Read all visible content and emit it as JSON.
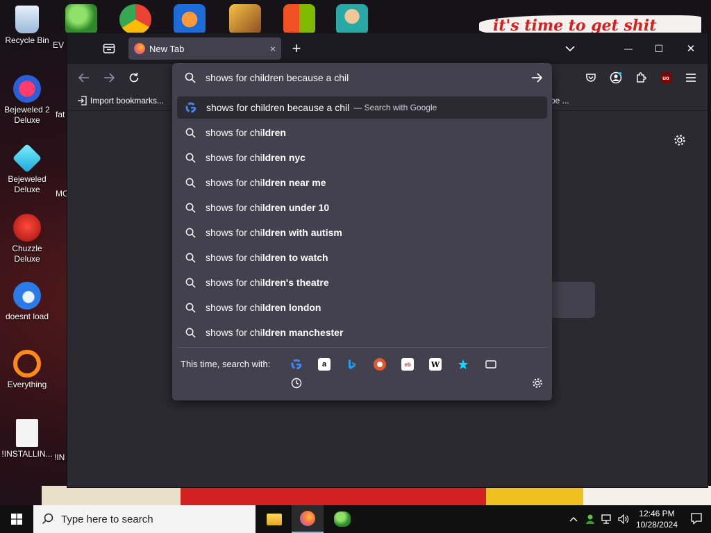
{
  "desktop": {
    "icons": [
      {
        "label": "Recycle Bin"
      },
      {
        "label": "Bejeweled 2 Deluxe"
      },
      {
        "label": "Bejeweled Deluxe"
      },
      {
        "label": "Chuzzle Deluxe"
      },
      {
        "label": "doesnt load"
      },
      {
        "label": "Everything"
      },
      {
        "label": "!INSTALLIN..."
      }
    ],
    "partial_labels": [
      "EV",
      "M",
      "fat",
      "MC",
      "f",
      "!IN"
    ],
    "banner_text": "it's time to get shit"
  },
  "browser": {
    "tab": {
      "title": "New Tab",
      "close": "×"
    },
    "new_tab": "+",
    "window_controls": {
      "minimize": "—",
      "maximize": "☐",
      "close": "✕"
    },
    "list_all_tabs": "⌄",
    "bookmarks": {
      "import": "Import bookmarks...",
      "right_partial": "pe ..."
    },
    "url": {
      "value": "shows for children because a chil",
      "suggestions": [
        {
          "prefix": "shows for children because a chil",
          "bold": "",
          "hint": "— Search with Google",
          "icon": "google-icon",
          "selected": true
        },
        {
          "prefix": "shows for chi",
          "bold": "ldren",
          "hint": "",
          "icon": "search-icon"
        },
        {
          "prefix": "shows for chi",
          "bold": "ldren nyc",
          "hint": "",
          "icon": "search-icon"
        },
        {
          "prefix": "shows for chi",
          "bold": "ldren near me",
          "hint": "",
          "icon": "search-icon"
        },
        {
          "prefix": "shows for chi",
          "bold": "ldren under 10",
          "hint": "",
          "icon": "search-icon"
        },
        {
          "prefix": "shows for chi",
          "bold": "ldren with autism",
          "hint": "",
          "icon": "search-icon"
        },
        {
          "prefix": "shows for chi",
          "bold": "ldren to watch",
          "hint": "",
          "icon": "search-icon"
        },
        {
          "prefix": "shows for chi",
          "bold": "ldren's theatre",
          "hint": "",
          "icon": "search-icon"
        },
        {
          "prefix": "shows for chi",
          "bold": "ldren london",
          "hint": "",
          "icon": "search-icon"
        },
        {
          "prefix": "shows for chi",
          "bold": "ldren manchester",
          "hint": "",
          "icon": "search-icon"
        }
      ],
      "search_with_label": "This time, search with:",
      "engines": [
        "google-icon",
        "amazon-icon",
        "bing-icon",
        "duckduckgo-icon",
        "ebay-icon",
        "wikipedia-icon",
        "bookmarks-star-icon",
        "tabs-icon",
        "history-icon"
      ],
      "engine_glyphs": {
        "amazon": "a",
        "ebay": "eb",
        "wikipedia": "W"
      }
    },
    "extension_badge": "uo"
  },
  "taskbar": {
    "search_placeholder": "Type here to search",
    "time": "12:46 PM",
    "date": "10/28/2024"
  },
  "colors": {
    "firefox_chrome": "#1c1b22",
    "panel": "#42414d",
    "toolbar": "#2b2a33",
    "text": "#fbfbfe"
  }
}
